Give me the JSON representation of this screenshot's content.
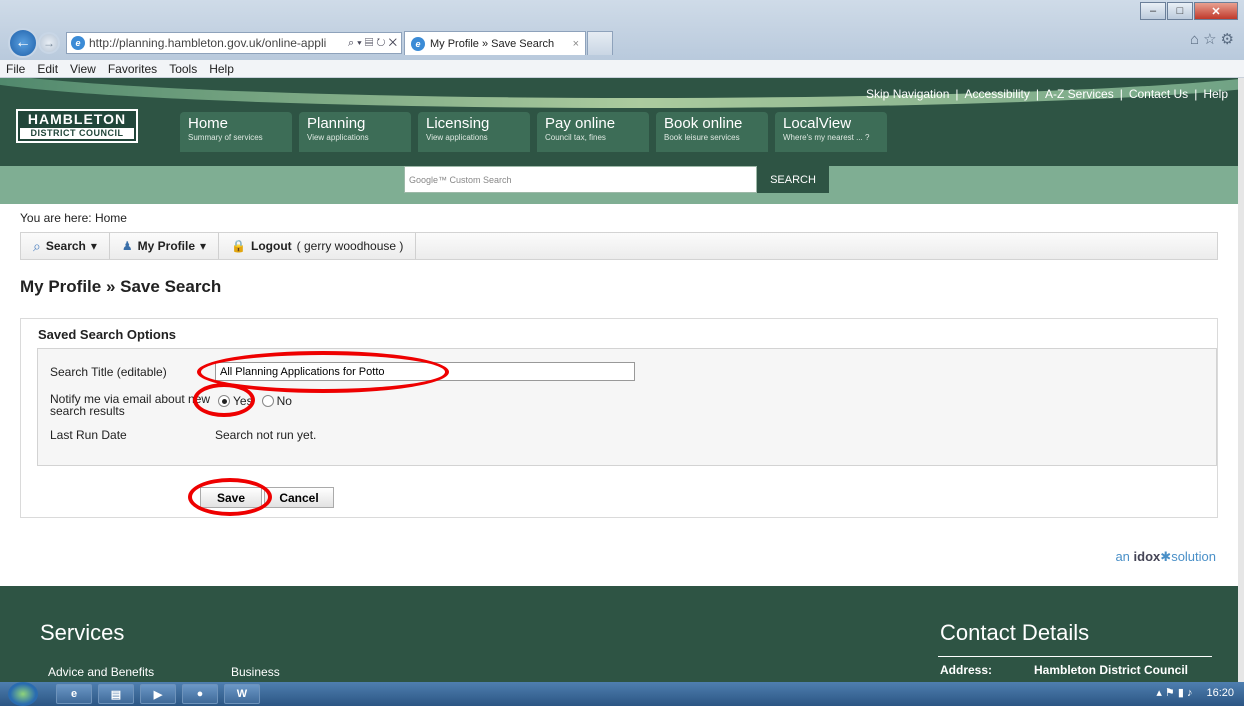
{
  "browser": {
    "url": "http://planning.hambleton.gov.uk/online-appli",
    "url_domain": "hambleton",
    "tab_title": "My Profile » Save Search",
    "menu": [
      "File",
      "Edit",
      "View",
      "Favorites",
      "Tools",
      "Help"
    ]
  },
  "site": {
    "skip_links": [
      "Skip Navigation",
      "Accessibility",
      "A-Z Services",
      "Contact Us",
      "Help"
    ],
    "logo_line1": "HAMBLETON",
    "logo_line2": "DISTRICT COUNCIL",
    "nav": [
      {
        "title": "Home",
        "sub": "Summary of services"
      },
      {
        "title": "Planning",
        "sub": "View applications"
      },
      {
        "title": "Licensing",
        "sub": "View applications"
      },
      {
        "title": "Pay online",
        "sub": "Council tax, fines"
      },
      {
        "title": "Book online",
        "sub": "Book leisure services"
      },
      {
        "title": "LocalView",
        "sub": "Where's my nearest ... ?"
      }
    ],
    "search_placeholder": "Google™ Custom Search",
    "search_button": "SEARCH"
  },
  "breadcrumb": {
    "prefix": "You are here:",
    "current": "Home"
  },
  "toolbar": {
    "search": "Search",
    "my_profile": "My Profile",
    "logout": "Logout",
    "logout_user": "( gerry woodhouse )"
  },
  "page_title": "My Profile » Save Search",
  "form": {
    "section_title": "Saved Search Options",
    "search_title_label": "Search Title (editable)",
    "search_title_value": "All Planning Applications for Potto",
    "notify_label_1": "Notify me via email about new",
    "notify_label_2": "search results",
    "yes": "Yes",
    "no": "No",
    "last_run_label": "Last Run Date",
    "last_run_value": "Search not run yet.",
    "save": "Save",
    "cancel": "Cancel"
  },
  "idox": {
    "pre": "an",
    "brand": "idox",
    "post": "solution"
  },
  "footer": {
    "services_title": "Services",
    "contact_title": "Contact Details",
    "services": [
      "Advice and Benefits",
      "Business"
    ],
    "address_label": "Address:",
    "address_value": "Hambleton District Council"
  },
  "taskbar": {
    "time": "16:20"
  }
}
